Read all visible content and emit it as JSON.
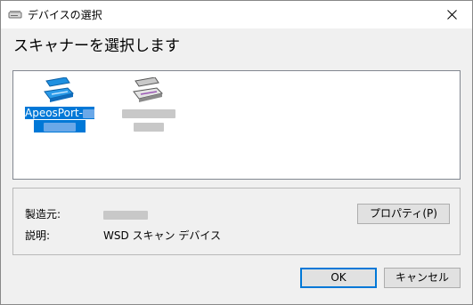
{
  "window": {
    "title": "デバイスの選択"
  },
  "heading": "スキャナーを選択します",
  "devices": [
    {
      "name": "ApeosPort-",
      "selected": true
    },
    {
      "name": "",
      "selected": false
    }
  ],
  "info": {
    "manufacturer_label": "製造元:",
    "description_label": "説明:",
    "description_value": "WSD スキャン デバイス"
  },
  "buttons": {
    "properties": "プロパティ(P)",
    "ok": "OK",
    "cancel": "キャンセル"
  },
  "icons": {
    "title": "scanner-icon",
    "close": "close-icon",
    "device": "scanner-icon"
  },
  "colors": {
    "selection": "#0078d7",
    "default_button_border": "#0078d7"
  }
}
